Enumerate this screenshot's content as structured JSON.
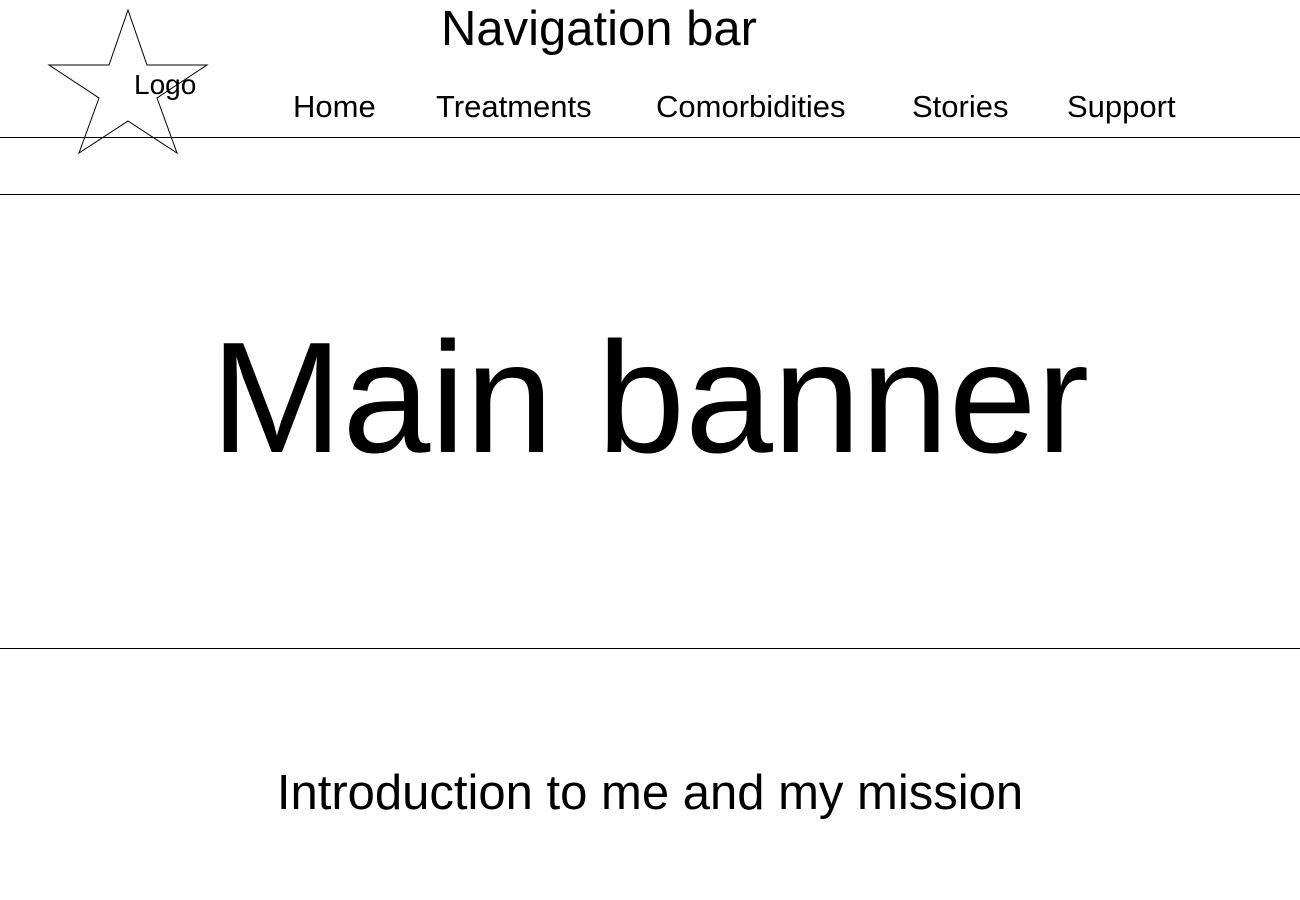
{
  "header": {
    "logo_label": "Logo",
    "title": "Navigation bar",
    "nav_items": [
      {
        "label": "Home"
      },
      {
        "label": "Treatments"
      },
      {
        "label": "Comorbidities"
      },
      {
        "label": "Stories"
      },
      {
        "label": "Support"
      }
    ]
  },
  "banner": {
    "title": "Main banner"
  },
  "intro": {
    "text": "Introduction to me and my mission"
  }
}
